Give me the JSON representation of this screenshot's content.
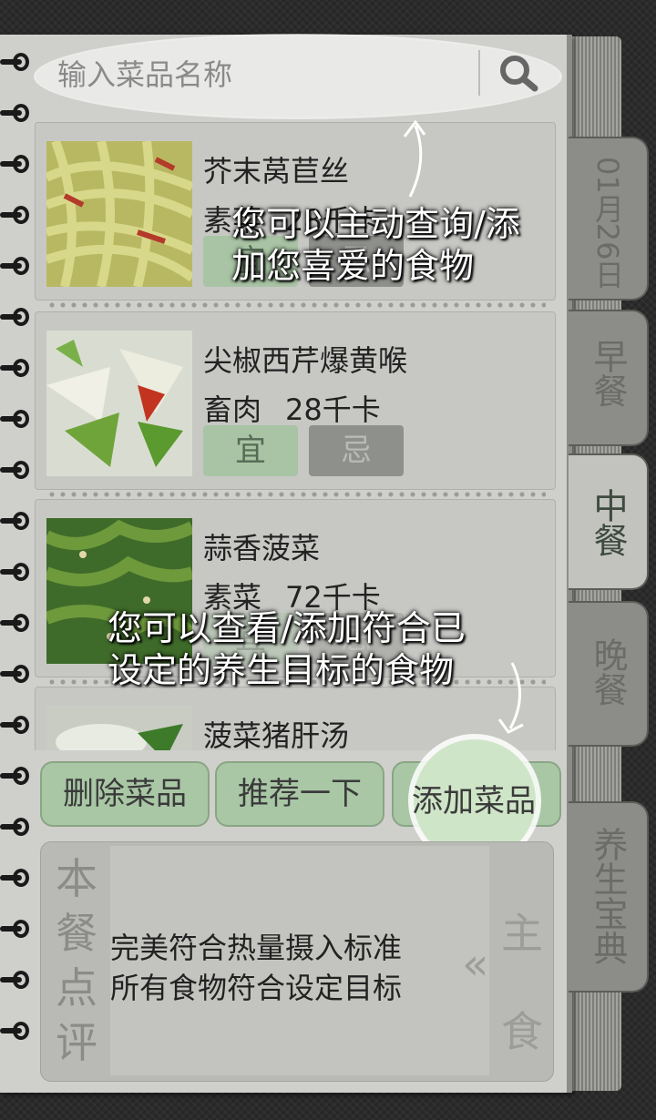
{
  "search": {
    "placeholder": "输入菜品名称"
  },
  "foods": [
    {
      "name": "芥末莴苣丝",
      "type": "素菜",
      "calories": "28千卡",
      "good": "宜",
      "bad": "忌"
    },
    {
      "name": "尖椒西芹爆黄喉",
      "type": "畜肉",
      "calories": "28千卡",
      "good": "宜",
      "bad": "忌"
    },
    {
      "name": "蒜香菠菜",
      "type": "素菜",
      "calories": "72千卡",
      "good": "宜",
      "bad": "忌"
    },
    {
      "name": "菠菜猪肝汤",
      "type": "",
      "calories": "",
      "good": "",
      "bad": ""
    }
  ],
  "actions": {
    "delete": "删除菜品",
    "recommend": "推荐一下",
    "add": "添加菜品"
  },
  "review": {
    "title": "本餐点评",
    "line1": "完美符合热量摄入标准",
    "line2": "所有食物符合设定目标",
    "side_label": "主食"
  },
  "tabs": {
    "date": "01月26日",
    "breakfast": "早餐",
    "lunch": "中餐",
    "dinner": "晚餐",
    "wellness": "养生宝典"
  },
  "hints": {
    "search_line1": "您可以主动查询/添",
    "search_line2": "加您喜爱的食物",
    "add_line1": "您可以查看/添加符合已",
    "add_line2": "设定的养生目标的食物"
  },
  "colors": {
    "accent_green": "#a9c7a5",
    "tab_active": "#c2c3bf"
  }
}
